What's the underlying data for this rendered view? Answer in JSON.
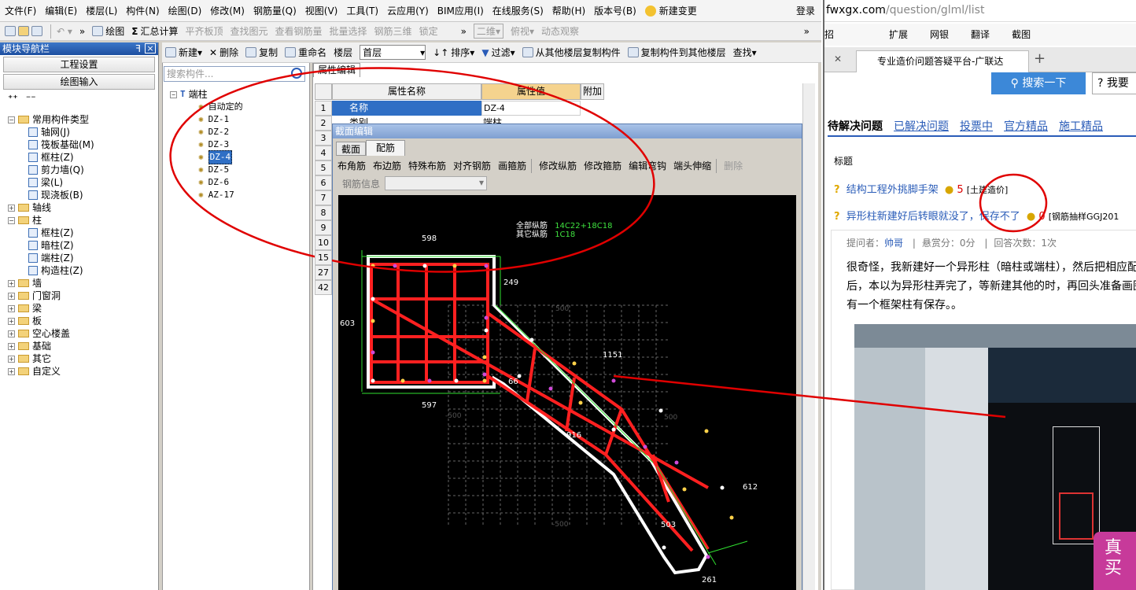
{
  "menu": [
    "文件(F)",
    "编辑(E)",
    "楼层(L)",
    "构件(N)",
    "绘图(D)",
    "修改(M)",
    "钢筋量(Q)",
    "视图(V)",
    "工具(T)",
    "云应用(Y)",
    "BIM应用(I)",
    "在线服务(S)",
    "帮助(H)",
    "版本号(B)"
  ],
  "menu_extra": {
    "new_change": "新建变更",
    "login": "登录"
  },
  "toolbar": {
    "draw": "绘图",
    "sum": "汇总计算",
    "align_slab": "平齐板顶",
    "find_elem": "查找图元",
    "view_rebar": "查看钢筋量",
    "batch_select": "批量选择",
    "rebar_3d": "钢筋三维",
    "lock": "锁定",
    "view_mode": "二维",
    "top_view": "俯视",
    "dynamic": "动态观察"
  },
  "nav": {
    "title": "模块导航栏",
    "btn_project": "工程设置",
    "btn_draw": "绘图输入",
    "tree": [
      {
        "label": "常用构件类型",
        "level": 0,
        "toggle": "−",
        "kind": "folder"
      },
      {
        "label": "轴网(J)",
        "level": 1,
        "kind": "comp"
      },
      {
        "label": "筏板基础(M)",
        "level": 1,
        "kind": "comp"
      },
      {
        "label": "框柱(Z)",
        "level": 1,
        "kind": "comp"
      },
      {
        "label": "剪力墙(Q)",
        "level": 1,
        "kind": "comp"
      },
      {
        "label": "梁(L)",
        "level": 1,
        "kind": "comp"
      },
      {
        "label": "现浇板(B)",
        "level": 1,
        "kind": "comp"
      },
      {
        "label": "轴线",
        "level": 0,
        "toggle": "+",
        "kind": "folder"
      },
      {
        "label": "柱",
        "level": 0,
        "toggle": "−",
        "kind": "folder"
      },
      {
        "label": "框柱(Z)",
        "level": 1,
        "kind": "comp"
      },
      {
        "label": "暗柱(Z)",
        "level": 1,
        "kind": "comp"
      },
      {
        "label": "端柱(Z)",
        "level": 1,
        "kind": "comp"
      },
      {
        "label": "构造柱(Z)",
        "level": 1,
        "kind": "comp"
      },
      {
        "label": "墙",
        "level": 0,
        "toggle": "+",
        "kind": "folder"
      },
      {
        "label": "门窗洞",
        "level": 0,
        "toggle": "+",
        "kind": "folder"
      },
      {
        "label": "梁",
        "level": 0,
        "toggle": "+",
        "kind": "folder"
      },
      {
        "label": "板",
        "level": 0,
        "toggle": "+",
        "kind": "folder"
      },
      {
        "label": "空心楼盖",
        "level": 0,
        "toggle": "+",
        "kind": "folder"
      },
      {
        "label": "基础",
        "level": 0,
        "toggle": "+",
        "kind": "folder"
      },
      {
        "label": "其它",
        "level": 0,
        "toggle": "+",
        "kind": "folder"
      },
      {
        "label": "自定义",
        "level": 0,
        "toggle": "+",
        "kind": "folder"
      }
    ]
  },
  "comp_toolbar": {
    "new": "新建",
    "delete": "删除",
    "copy": "复制",
    "rename": "重命名",
    "floor_label": "楼层",
    "floor": "首层",
    "sort": "排序",
    "filter": "过滤",
    "copy_from": "从其他楼层复制构件",
    "copy_to": "复制构件到其他楼层",
    "find": "查找"
  },
  "comp_list": {
    "search_placeholder": "搜索构件...",
    "root": "端柱",
    "items": [
      "自动定的",
      "DZ-1",
      "DZ-2",
      "DZ-3",
      "DZ-4",
      "DZ-5",
      "DZ-6",
      "AZ-17"
    ],
    "selected": "DZ-4"
  },
  "props": {
    "tab": "属性编辑",
    "col_name": "属性名称",
    "col_value": "属性值",
    "col_extra": "附加",
    "row_numbers": [
      "1",
      "2",
      "3",
      "4",
      "5",
      "6",
      "7",
      "8",
      "9",
      "10",
      "15",
      "27",
      "42"
    ],
    "row1_name": "名称",
    "row1_value": "DZ-4",
    "row2_name": "类别",
    "row2_value": "端柱"
  },
  "section_editor": {
    "title": "截面编辑",
    "tabs": [
      "截面",
      "配筋"
    ],
    "tools": [
      "布角筋",
      "布边筋",
      "特殊布筋",
      "对齐钢筋",
      "画箍筋",
      "修改纵筋",
      "修改箍筋",
      "编辑弯钩",
      "端头伸缩",
      "删除"
    ],
    "rebar_info_label": "钢筋信息",
    "note_all_label": "全部纵筋",
    "note_all_value": "14C22+18C18",
    "note_other_label": "其它纵筋",
    "note_other_value": "1C18",
    "dims": {
      "top": "598",
      "left": "603",
      "notch": "249",
      "bottom": "597",
      "diag_top": "1151",
      "diag_bottom": "916",
      "right": "612",
      "inner": "503",
      "end": "261",
      "grid_a": "500",
      "grid_b": "-500",
      "grid_c": "500",
      "grid_d": "-500",
      "small": "66"
    }
  },
  "browser": {
    "url_domain": "fwxgx.com",
    "url_path": "/question/glml/list",
    "bookmarks": [
      "招",
      "扩展",
      "网银",
      "翻译",
      "截图"
    ],
    "tab_title": "专业造价问题答疑平台-广联达",
    "search_btn": "搜索一下",
    "ask_btn": "我要",
    "tabs": [
      "待解决问题",
      "已解决问题",
      "投票中",
      "官方精品",
      "施工精品"
    ],
    "col_title": "标题",
    "q1_title": "结构工程外挑脚手架",
    "q1_score": "5",
    "q1_tag": "[土建造价]",
    "q2_title": "异形柱新建好后转眼就没了，保存不了",
    "q2_score": "0",
    "q2_tag": "[钢筋抽样GGJ201",
    "asker_label": "提问者：",
    "asker": "帅哥",
    "reward": "悬赏分：0分",
    "answers": "回答次数：1次",
    "body1": "很奇怪，我新建好一个异形柱（暗柱或端柱），然后把相应配",
    "body2": "后，本以为异形柱弄完了，等新建其他的时，再回头准备画图",
    "body3": "有一个框架柱有保存。。",
    "ad_line1": "真",
    "ad_line2": "买"
  },
  "colors": {
    "annotation": "#e00000",
    "cad_bg": "#000000",
    "rebar": "#ff2020",
    "outline": "#ffffff",
    "dim": "#30e030",
    "title_blue": "#2a5cb8"
  }
}
